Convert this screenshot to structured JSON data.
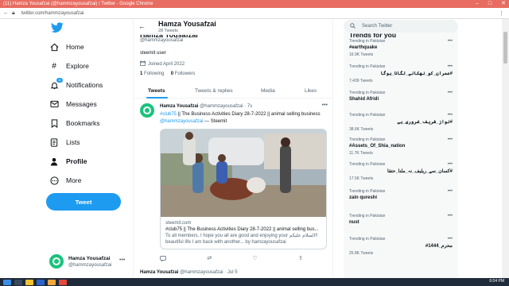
{
  "window": {
    "title": "(11) Hamza Yousafzai (@hammzayousafzai) / Twitter - Google Chrome",
    "url": "twitter.com/hammzayousafzai"
  },
  "sidebar": {
    "items": [
      {
        "label": "Home",
        "icon": "home-icon"
      },
      {
        "label": "Explore",
        "icon": "hash-icon"
      },
      {
        "label": "Notifications",
        "icon": "bell-icon",
        "badge": "11"
      },
      {
        "label": "Messages",
        "icon": "mail-icon"
      },
      {
        "label": "Bookmarks",
        "icon": "bookmark-icon"
      },
      {
        "label": "Lists",
        "icon": "list-icon"
      },
      {
        "label": "Profile",
        "icon": "person-icon"
      },
      {
        "label": "More",
        "icon": "more-circle-icon"
      }
    ],
    "tweet_button": "Tweet",
    "account": {
      "name": "Hamza Yousafzai",
      "handle": "@hammzayousafzai"
    }
  },
  "profile": {
    "header_name": "Hamza Yousafzai",
    "tweet_count": "28 Tweets",
    "name": "Hamza Yousafzai",
    "handle": "@hammzayousafzai",
    "bio": "steemit user",
    "joined": "Joined April 2022",
    "following_count": "1",
    "following_label": "Following",
    "followers_count": "0",
    "followers_label": "Followers"
  },
  "tabs": [
    "Tweets",
    "Tweets & replies",
    "Media",
    "Likes"
  ],
  "tweet": {
    "name": "Hamza Yousafzai",
    "handle": "@hammzayousafzai · 7s",
    "text_tag": "#club75",
    "text_body": " || The Business Activities Diary 28-7-2022 || animal selling business",
    "text_mention": "@hammzayousafzai",
    "text_tail": " — Steemit",
    "card_domain": "steemit.com",
    "card_title": "#club75 || The Business Activities Diary 28-7-2022 || animal selling bus...",
    "card_desc": "To all members, I hope you all are good and enjoying your السلام علیکم!! beautiful life I am back with another... by hamzayousafzai"
  },
  "next_tweet": {
    "name": "Hamza Yousafzai",
    "handle": "@hammzayousafzai · Jul 5"
  },
  "search": {
    "placeholder": "Search Twitter"
  },
  "trends": {
    "title": "Trends for you",
    "items": [
      {
        "context": "Trending in Pakistan",
        "name": "#earthquake",
        "count": "16.9K Tweets",
        "rtl": false
      },
      {
        "context": "Trending in Pakistan",
        "name": "#عمران_کو_نھکانے_لگانا_ہوگا",
        "count": "7,439 Tweets",
        "rtl": true
      },
      {
        "context": "Trending in Pakistan",
        "name": "Shahid Afridi",
        "count": "",
        "rtl": false
      },
      {
        "context": "Trending in Pakistan",
        "name": "#نواز_شریف_ضروری_ہے",
        "count": "38.6K Tweets",
        "rtl": true
      },
      {
        "context": "Trending in Pakistan",
        "name": "#Assets_Of_Shia_nation",
        "count": "11.7K Tweets",
        "rtl": false
      },
      {
        "context": "Trending in Pakistan",
        "name": "#کسان_سے_ریلیف_نہ_ملنا_حتقا",
        "count": "17.5K Tweets",
        "rtl": true
      },
      {
        "context": "Trending in Pakistan",
        "name": "zain qureshi",
        "count": "",
        "rtl": false
      },
      {
        "context": "Trending in Pakistan",
        "name": "nust",
        "count": "",
        "rtl": false
      },
      {
        "context": "Trending in Pakistan",
        "name": "محرم_1444#",
        "count": "25.8K Tweets",
        "rtl": true
      }
    ]
  },
  "taskbar": {
    "time": "6:04 PM"
  }
}
